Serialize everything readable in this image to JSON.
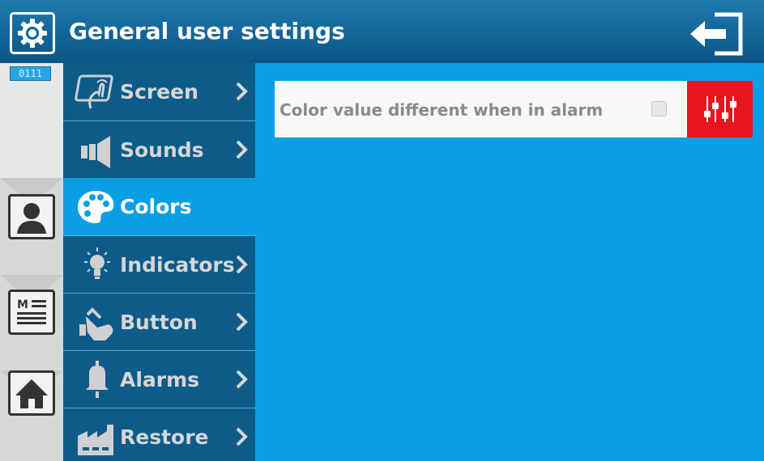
{
  "header": {
    "title": "General user settings",
    "settings_icon": "gear-icon",
    "exit_icon": "exit-icon"
  },
  "left_column": {
    "code_badge": "0111",
    "buttons": [
      {
        "icon": "user-profile-icon"
      },
      {
        "icon": "document-menu-icon"
      },
      {
        "icon": "home-icon"
      }
    ]
  },
  "menu": {
    "items": [
      {
        "label": "Screen",
        "icon": "touch-screen-icon",
        "active": false
      },
      {
        "label": "Sounds",
        "icon": "speaker-icon",
        "active": false
      },
      {
        "label": "Colors",
        "icon": "palette-icon",
        "active": true
      },
      {
        "label": "Indicators",
        "icon": "lightbulb-icon",
        "active": false
      },
      {
        "label": "Button",
        "icon": "hand-press-icon",
        "active": false
      },
      {
        "label": "Alarms",
        "icon": "bell-icon",
        "active": false
      },
      {
        "label": "Restore",
        "icon": "factory-icon",
        "active": false
      }
    ]
  },
  "settings": {
    "color_alarm": {
      "label": "Color value different when in alarm",
      "checked": false,
      "adjust_icon": "sliders-icon"
    }
  },
  "colors": {
    "header": "#0b5685",
    "menu_item": "#0d5b89",
    "background": "#0a9fe3",
    "alert_button": "#e8161c"
  }
}
